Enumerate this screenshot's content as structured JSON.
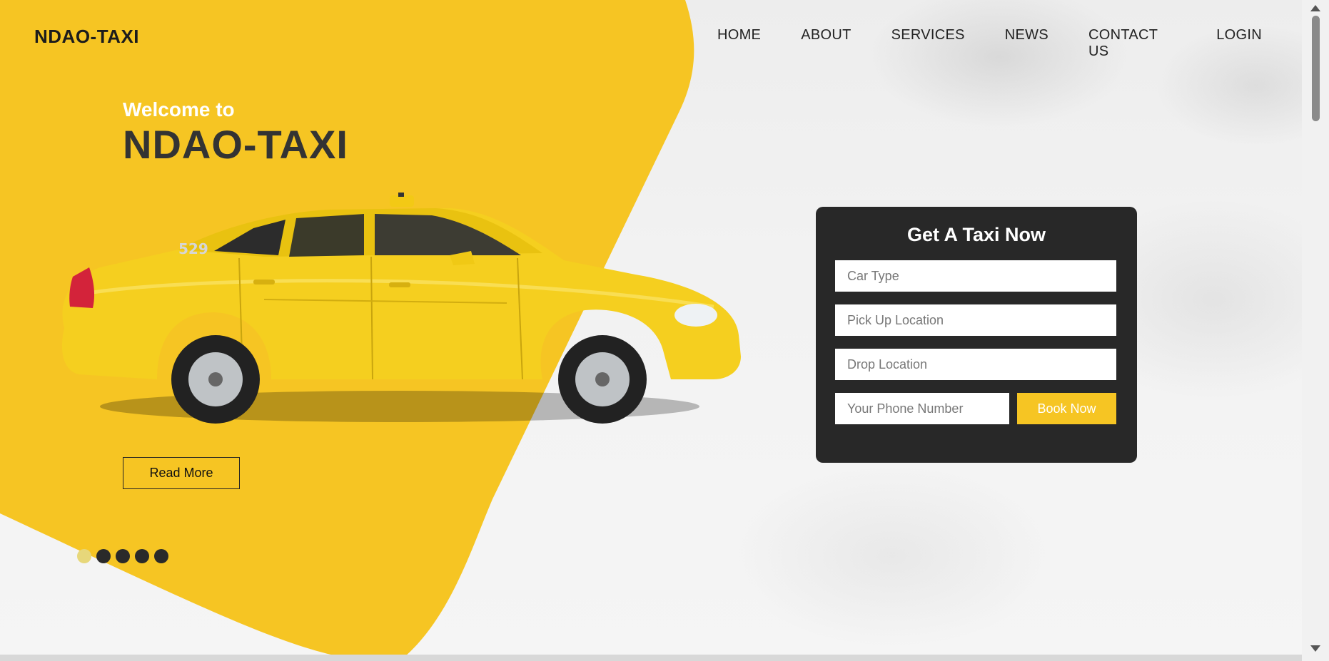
{
  "brand": {
    "logo_text": "NDAO-TAXI"
  },
  "nav": {
    "items": [
      {
        "label": "HOME"
      },
      {
        "label": "ABOUT"
      },
      {
        "label": "SERVICES"
      },
      {
        "label": "NEWS"
      },
      {
        "label": "CONTACT US"
      },
      {
        "label": "LOGIN"
      }
    ]
  },
  "hero": {
    "welcome": "Welcome to",
    "title": "NDAO-TAXI",
    "read_more_label": "Read More",
    "car_number": "529",
    "slides": {
      "count": 5,
      "active_index": 0
    }
  },
  "booking": {
    "title": "Get A Taxi Now",
    "car_type_placeholder": "Car Type",
    "pickup_placeholder": "Pick Up Location",
    "drop_placeholder": "Drop Location",
    "phone_placeholder": "Your Phone Number",
    "submit_label": "Book Now"
  },
  "colors": {
    "accent_yellow": "#f6c523",
    "panel_dark": "#282828",
    "text_dark": "#333333"
  }
}
